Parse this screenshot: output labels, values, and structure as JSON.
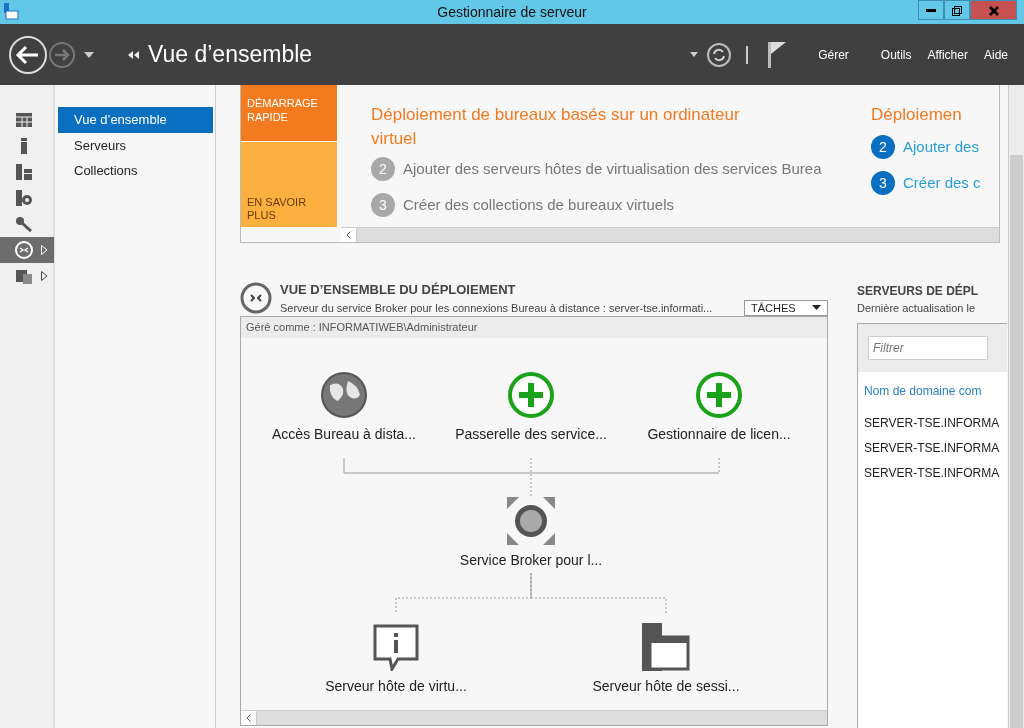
{
  "window": {
    "title": "Gestionnaire de serveur"
  },
  "header": {
    "breadcrumb": "Vue d’ensemble",
    "menus": [
      "Gérer",
      "Outils",
      "Afficher",
      "Aide"
    ]
  },
  "rail": [
    {
      "kind": "dashboard",
      "selected": false,
      "expandable": false
    },
    {
      "kind": "server",
      "selected": false,
      "expandable": false
    },
    {
      "kind": "servers",
      "selected": false,
      "expandable": false
    },
    {
      "kind": "file-server",
      "selected": false,
      "expandable": false
    },
    {
      "kind": "key",
      "selected": false,
      "expandable": false
    },
    {
      "kind": "remote",
      "selected": true,
      "expandable": true
    },
    {
      "kind": "files",
      "selected": false,
      "expandable": true
    }
  ],
  "nav": [
    {
      "label": "Vue d’ensemble",
      "selected": true
    },
    {
      "label": "Serveurs",
      "selected": false
    },
    {
      "label": "Collections",
      "selected": false
    }
  ],
  "quick_start": {
    "tiles": [
      {
        "label": "DÉMARRAGE RAPIDE",
        "selected": true
      },
      {
        "label": "EN SAVOIR PLUS",
        "selected": false
      }
    ],
    "columns": [
      {
        "title": "Déploiement de bureaux basés sur un ordinateur virtuel",
        "steps": [
          {
            "number": "2",
            "label": "Ajouter des serveurs hôtes de virtualisation des services Burea",
            "active": false
          },
          {
            "number": "3",
            "label": "Créer des collections de bureaux virtuels",
            "active": false
          }
        ]
      },
      {
        "title": "Déploiemen",
        "steps": [
          {
            "number": "2",
            "label": "Ajouter des",
            "active": true
          },
          {
            "number": "3",
            "label": "Créer des c",
            "active": true
          }
        ]
      }
    ]
  },
  "deployment": {
    "title": "VUE D’ENSEMBLE DU DÉPLOIEMENT",
    "subtitle": "Serveur du service Broker pour les connexions Bureau à distance : server-tse.informati...",
    "tasks": "TÂCHES",
    "managed_as": "Géré comme : INFORMATIWEB\\Administrateur",
    "nodes": [
      {
        "label": "Accès Bureau à dista...",
        "kind": "globe"
      },
      {
        "label": "Passerelle des service...",
        "kind": "add"
      },
      {
        "label": "Gestionnaire de licen...",
        "kind": "add"
      },
      {
        "label": "Service Broker pour l...",
        "kind": "broker"
      },
      {
        "label": "Serveur hôte de virtu...",
        "kind": "info"
      },
      {
        "label": "Serveur hôte de sessi...",
        "kind": "window"
      }
    ]
  },
  "servers": {
    "title": "SERVEURS DE DÉPL",
    "subtitle": "Dernière actualisation le",
    "filter": {
      "placeholder": "Filtrer"
    },
    "column": "Nom de domaine com",
    "rows": [
      "SERVER-TSE.INFORMA",
      "SERVER-TSE.INFORMA",
      "SERVER-TSE.INFORMA"
    ]
  }
}
